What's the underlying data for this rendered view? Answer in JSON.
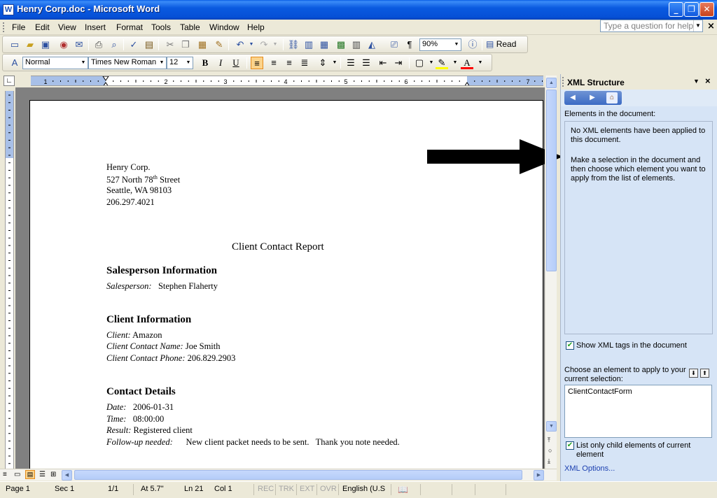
{
  "window": {
    "title": "Henry Corp.doc - Microsoft Word",
    "app_icon": "W"
  },
  "menu": [
    "File",
    "Edit",
    "View",
    "Insert",
    "Format",
    "Tools",
    "Table",
    "Window",
    "Help"
  ],
  "help_box": {
    "placeholder": "Type a question for help"
  },
  "standard_toolbar": {
    "zoom": "90%",
    "read_label": "Read"
  },
  "formatting_toolbar": {
    "style": "Normal",
    "font": "Times New Roman",
    "size": "12"
  },
  "ruler": {
    "numbers": [
      "1",
      "1",
      "2",
      "3",
      "4",
      "5",
      "6",
      "7"
    ]
  },
  "document": {
    "address": [
      "Henry Corp.",
      "527 North 78",
      "th",
      " Street",
      "Seattle, WA  98103",
      "206.297.4021"
    ],
    "report_title": "Client Contact Report",
    "sections": {
      "salesperson_heading": "Salesperson Information",
      "salesperson_label": "Salesperson:",
      "salesperson_value": "Stephen Flaherty",
      "client_heading": "Client Information",
      "client_label": "Client:",
      "client_value": "Amazon",
      "contact_name_label": "Client Contact Name:",
      "contact_name_value": "Joe Smith",
      "contact_phone_label": "Client Contact Phone:",
      "contact_phone_value": "206.829.2903",
      "details_heading": "Contact Details",
      "date_label": "Date:",
      "date_value": "2006-01-31",
      "time_label": "Time:",
      "time_value": "08:00:00",
      "result_label": "Result:",
      "result_value": "Registered client",
      "followup_label": "Follow-up needed:",
      "followup_value": "New client packet needs to be sent.   Thank you note needed."
    }
  },
  "task_pane": {
    "title": "XML Structure",
    "elements_label": "Elements in the document:",
    "no_elements_msg": "No XML elements have been applied to this document.",
    "instructions": "Make a selection in the document and then choose which element you want to apply from the list of elements.",
    "show_tags_label": "Show XML tags in the document",
    "show_tags_checked": true,
    "choose_label": "Choose an element to apply to your current selection:",
    "element_list": [
      "ClientContactForm"
    ],
    "list_only_label": "List only child elements of current element",
    "list_only_checked": true,
    "xml_options_link": "XML Options..."
  },
  "status_bar": {
    "page": "Page 1",
    "sec": "Sec 1",
    "pages": "1/1",
    "at": "At 5.7\"",
    "ln": "Ln 21",
    "col": "Col 1",
    "rec": "REC",
    "trk": "TRK",
    "ext": "EXT",
    "ovr": "OVR",
    "language": "English (U.S"
  },
  "colors": {
    "titlebar": "#0a5ae0",
    "taskpane": "#d6e4f6",
    "link": "#1b3fb0"
  }
}
